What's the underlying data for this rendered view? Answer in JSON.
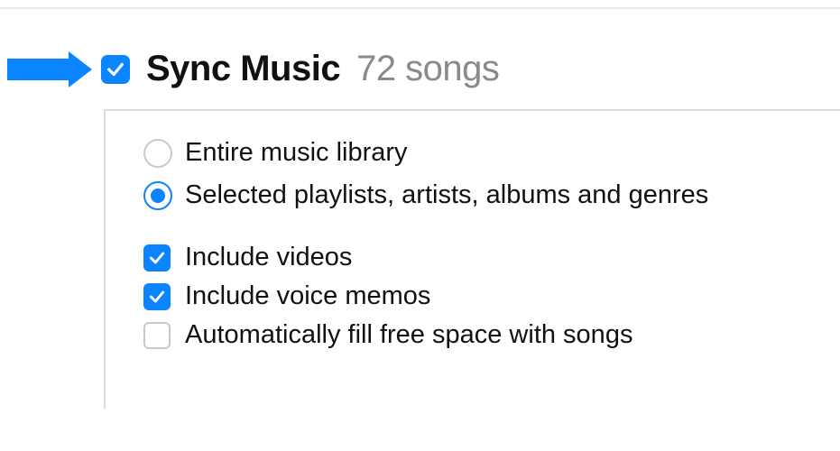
{
  "colors": {
    "accent": "#0a84ff",
    "muted": "#8a8a8a",
    "border": "#dcdcdc"
  },
  "header": {
    "sync_music_checked": true,
    "title": "Sync Music",
    "count_label": "72 songs"
  },
  "radios": {
    "entire_library": "Entire music library",
    "selected_items": "Selected playlists, artists, albums and genres",
    "selected_value": "selected_items"
  },
  "checks": {
    "include_videos": {
      "label": "Include videos",
      "checked": true
    },
    "include_voice_memos": {
      "label": "Include voice memos",
      "checked": true
    },
    "auto_fill": {
      "label": "Automatically fill free space with songs",
      "checked": false
    }
  }
}
